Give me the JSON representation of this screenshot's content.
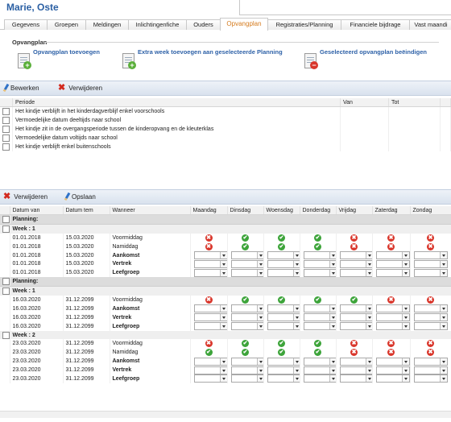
{
  "person_name": "Marie, Oste",
  "tabs": [
    {
      "label": "Gegevens",
      "active": false
    },
    {
      "label": "Groepen",
      "active": false
    },
    {
      "label": "Meldingen",
      "active": false
    },
    {
      "label": "Inlichtingenfiche",
      "active": false
    },
    {
      "label": "Ouders",
      "active": false
    },
    {
      "label": "Opvangplan",
      "active": true
    },
    {
      "label": "Registraties/Planning",
      "active": false
    },
    {
      "label": "Financiele bijdrage",
      "active": false
    },
    {
      "label": "Vast maandi",
      "active": false
    }
  ],
  "section": {
    "title": "Opvangplan",
    "actions": [
      {
        "label": "Opvangplan toevoegen",
        "icon": "document-add-icon"
      },
      {
        "label": "Extra week toevoegen aan geselecteerde Planning",
        "icon": "document-add-icon"
      },
      {
        "label": "Geselecteerd opvangplan beëindigen",
        "icon": "document-remove-icon"
      }
    ]
  },
  "toolbar1": {
    "edit_label": "Bewerken",
    "delete_label": "Verwijderen"
  },
  "plan_grid": {
    "headers": {
      "periode": "Periode",
      "van": "Van",
      "tot": "Tot"
    },
    "rows": [
      "Het kindje verblijft in het kinderdagverblijf enkel voorschools",
      "Vermoedelijke datum deeltijds naar school",
      "Het kindje zit in de overgangsperiode tussen de kinderopvang en de kleuterklas",
      "Vermoedelijke datum voltijds naar school",
      "Het kindje verblijft enkel buitenschools"
    ]
  },
  "toolbar2": {
    "delete_label": "Verwijderen",
    "save_label": "Opslaan"
  },
  "schedule": {
    "headers": [
      "Datum van",
      "Datum tem",
      "Wanneer",
      "Maandag",
      "Dinsdag",
      "Woensdag",
      "Donderdag",
      "Vrijdag",
      "Zaterdag",
      "Zondag"
    ],
    "groups": [
      {
        "planning_label": "Planning:",
        "weeks": [
          {
            "week_label": "Week : 1",
            "rows": [
              {
                "from": "01.01.2018",
                "to": "15.03.2020",
                "when": "Voormiddag",
                "bold": false,
                "type": "icons",
                "days": [
                  "no",
                  "ok",
                  "ok",
                  "ok",
                  "no",
                  "no",
                  "no"
                ]
              },
              {
                "from": "01.01.2018",
                "to": "15.03.2020",
                "when": "Namiddag",
                "bold": false,
                "type": "icons",
                "days": [
                  "no",
                  "ok",
                  "ok",
                  "ok",
                  "no",
                  "no",
                  "no"
                ]
              },
              {
                "from": "01.01.2018",
                "to": "15.03.2020",
                "when": "Aankomst",
                "bold": true,
                "type": "select"
              },
              {
                "from": "01.01.2018",
                "to": "15.03.2020",
                "when": "Vertrek",
                "bold": true,
                "type": "select"
              },
              {
                "from": "01.01.2018",
                "to": "15.03.2020",
                "when": "Leefgroep",
                "bold": true,
                "type": "select"
              }
            ]
          }
        ]
      },
      {
        "planning_label": "Planning:",
        "weeks": [
          {
            "week_label": "Week : 1",
            "rows": [
              {
                "from": "16.03.2020",
                "to": "31.12.2099",
                "when": "Voormiddag",
                "bold": false,
                "type": "icons",
                "days": [
                  "no",
                  "ok",
                  "ok",
                  "ok",
                  "ok",
                  "no",
                  "no"
                ]
              },
              {
                "from": "16.03.2020",
                "to": "31.12.2099",
                "when": "Aankomst",
                "bold": true,
                "type": "select"
              },
              {
                "from": "16.03.2020",
                "to": "31.12.2099",
                "when": "Vertrek",
                "bold": true,
                "type": "select"
              },
              {
                "from": "16.03.2020",
                "to": "31.12.2099",
                "when": "Leefgroep",
                "bold": true,
                "type": "select"
              }
            ]
          },
          {
            "week_label": "Week : 2",
            "rows": [
              {
                "from": "23.03.2020",
                "to": "31.12.2099",
                "when": "Voormiddag",
                "bold": false,
                "type": "icons",
                "days": [
                  "no",
                  "ok",
                  "ok",
                  "ok",
                  "no",
                  "no",
                  "no"
                ]
              },
              {
                "from": "23.03.2020",
                "to": "31.12.2099",
                "when": "Namiddag",
                "bold": false,
                "type": "icons",
                "days": [
                  "ok",
                  "ok",
                  "ok",
                  "ok",
                  "no",
                  "no",
                  "no"
                ]
              },
              {
                "from": "23.03.2020",
                "to": "31.12.2099",
                "when": "Aankomst",
                "bold": true,
                "type": "select"
              },
              {
                "from": "23.03.2020",
                "to": "31.12.2099",
                "when": "Vertrek",
                "bold": true,
                "type": "select"
              },
              {
                "from": "23.03.2020",
                "to": "31.12.2099",
                "when": "Leefgroep",
                "bold": true,
                "type": "select"
              }
            ]
          }
        ]
      }
    ]
  },
  "colors": {
    "accent": "#2a5fa3",
    "active_tab": "#d57b1e",
    "ok": "#3da43a",
    "no": "#d9362b"
  }
}
